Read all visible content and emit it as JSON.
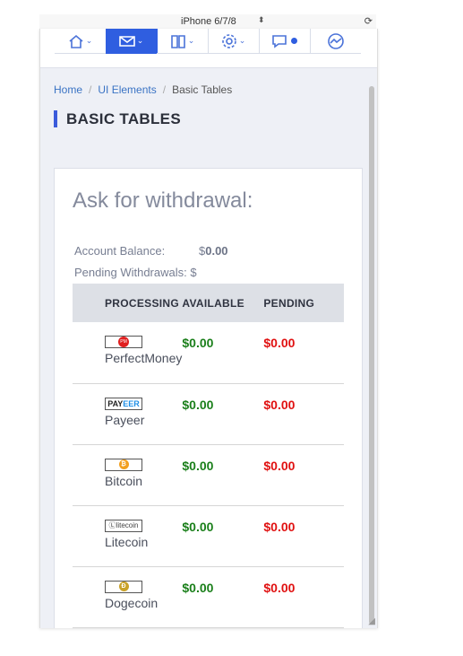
{
  "device_toolbar": {
    "device": "iPhone 6/7/8"
  },
  "nav": {
    "items": [
      "home",
      "inbox",
      "bookmarks",
      "settings",
      "messages",
      "analytics"
    ]
  },
  "breadcrumb": {
    "home": "Home",
    "section": "UI Elements",
    "current": "Basic Tables"
  },
  "page": {
    "title": "BASIC TABLES"
  },
  "card": {
    "title": "Ask for withdrawal:",
    "balance_label": "Account Balance:",
    "balance_currency": "$",
    "balance_value": "0.00",
    "pending_label": "Pending Withdrawals: $"
  },
  "table": {
    "headers": [
      "PROCESSING",
      "AVAILABLE",
      "PENDING"
    ],
    "rows": [
      {
        "name": "PerfectMoney",
        "available": "$0.00",
        "pending": "$0.00",
        "logo_text": "PM"
      },
      {
        "name": "Payeer",
        "available": "$0.00",
        "pending": "$0.00",
        "logo_text_a": "PAY",
        "logo_text_b": "EER"
      },
      {
        "name": "Bitcoin",
        "available": "$0.00",
        "pending": "$0.00",
        "logo_text": "₿"
      },
      {
        "name": "Litecoin",
        "available": "$0.00",
        "pending": "$0.00",
        "logo_text": "Ⓛlitecoin"
      },
      {
        "name": "Dogecoin",
        "available": "$0.00",
        "pending": "$0.00",
        "logo_text": "Ð"
      }
    ]
  },
  "colors": {
    "accent": "#2f5ee0",
    "available": "#1a7f1a",
    "pending": "#e01010",
    "title_bar": "#3b5bdb"
  }
}
